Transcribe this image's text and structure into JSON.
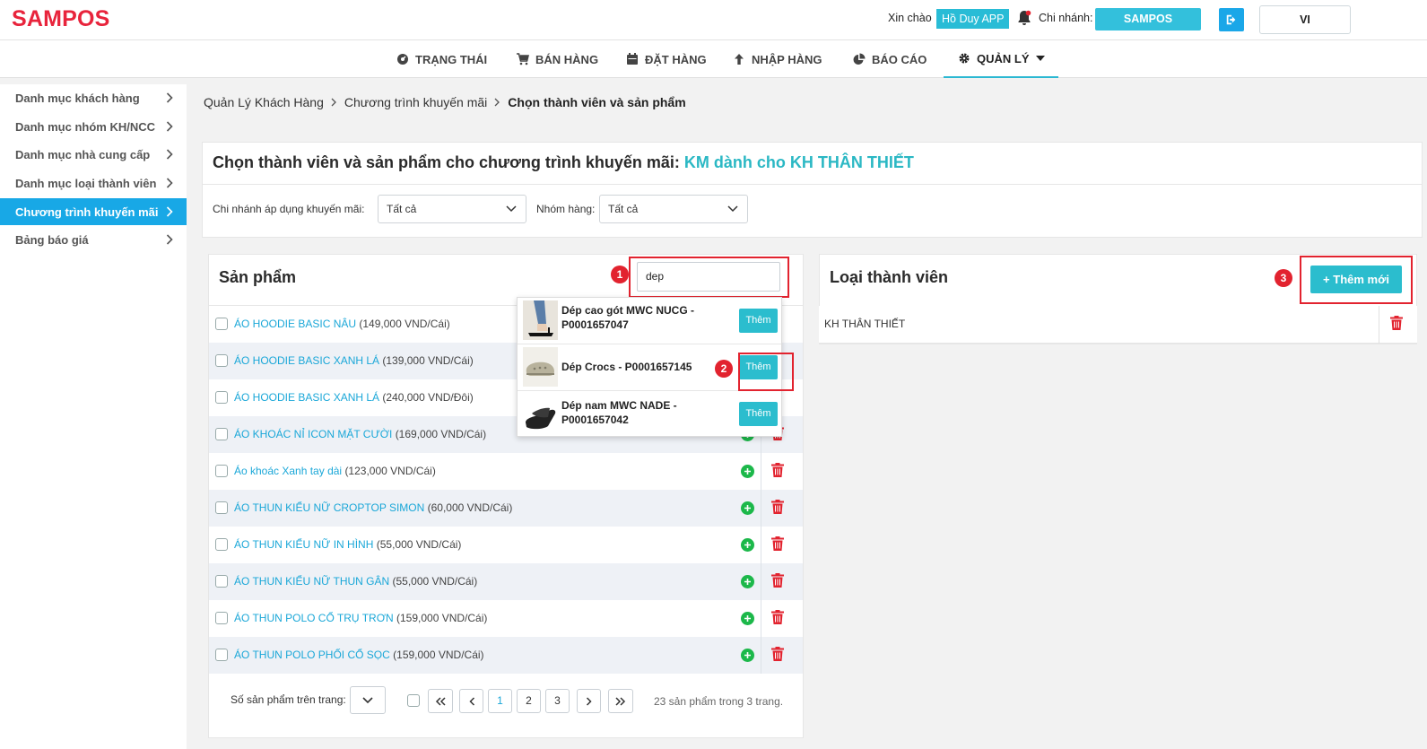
{
  "header": {
    "logo": "SAMPOS",
    "greeting": "Xin chào",
    "user_name": "Hồ Duy APP",
    "branch_label": "Chi nhánh:",
    "branch_value": "SAMPOS",
    "language": "VI"
  },
  "nav": {
    "items": [
      {
        "label": "TRẠNG THÁI",
        "icon": "dashboard-icon"
      },
      {
        "label": "BÁN HÀNG",
        "icon": "cart-icon"
      },
      {
        "label": "ĐẶT HÀNG",
        "icon": "calendar-icon"
      },
      {
        "label": "NHẬP HÀNG",
        "icon": "arrow-up-icon"
      },
      {
        "label": "BÁO CÁO",
        "icon": "pie-chart-icon"
      },
      {
        "label": "QUẢN LÝ",
        "icon": "gear-icon",
        "active": true
      }
    ]
  },
  "sidebar": {
    "items": [
      {
        "label": "Danh mục khách hàng"
      },
      {
        "label": "Danh mục nhóm KH/NCC"
      },
      {
        "label": "Danh mục nhà cung cấp"
      },
      {
        "label": "Danh mục loại thành viên"
      },
      {
        "label": "Chương trình khuyến mãi",
        "active": true
      },
      {
        "label": "Bảng báo giá"
      }
    ]
  },
  "breadcrumb": [
    "Quản Lý Khách Hàng",
    "Chương trình khuyến mãi",
    "Chọn thành viên và sản phẩm"
  ],
  "page": {
    "title": "Chọn thành viên và sản phẩm cho chương trình khuyến mãi:",
    "promo_name": "KM dành cho KH THÂN THIẾT",
    "filter_branch_label": "Chi nhánh áp dụng khuyến mãi:",
    "filter_branch_value": "Tất cả",
    "filter_group_label": "Nhóm hàng:",
    "filter_group_value": "Tất cả"
  },
  "products": {
    "title": "Sản phẩm",
    "search_value": "dep",
    "rows": [
      {
        "name": "ÁO HOODIE BASIC NÂU",
        "price": "(149,000 VND/Cái)"
      },
      {
        "name": "ÁO HOODIE BASIC XANH LÁ",
        "price": "(139,000 VND/Cái)"
      },
      {
        "name": "ÁO HOODIE BASIC XANH LÁ",
        "price": "(240,000 VND/Đôi)"
      },
      {
        "name": "ÁO KHOÁC NỈ ICON MẶT CƯỜI",
        "price": "(169,000 VND/Cái)"
      },
      {
        "name": "Áo khoác Xanh tay dài",
        "price": "(123,000 VND/Cái)"
      },
      {
        "name": "ÁO THUN KIỂU NỮ CROPTOP SIMON",
        "price": "(60,000 VND/Cái)"
      },
      {
        "name": "ÁO THUN KIỂU NỮ IN HÌNH",
        "price": "(55,000 VND/Cái)"
      },
      {
        "name": "ÁO THUN KIỂU NỮ THUN GÂN",
        "price": "(55,000 VND/Cái)"
      },
      {
        "name": "ÁO THUN POLO CỔ TRỤ TRƠN",
        "price": "(159,000 VND/Cái)"
      },
      {
        "name": "ÁO THUN POLO PHỐI CỔ SỌC",
        "price": "(159,000 VND/Cái)"
      }
    ],
    "suggestions": [
      {
        "name": "Dép cao gót MWC NUCG - P0001657047",
        "button": "Thêm"
      },
      {
        "name": "Dép Crocs - P0001657145",
        "button": "Thêm"
      },
      {
        "name": "Dép nam MWC NADE - P0001657042",
        "button": "Thêm"
      }
    ],
    "pagination": {
      "per_page_label": "Số sản phẩm trên trang:",
      "pages": [
        "1",
        "2",
        "3"
      ],
      "current": "1",
      "summary": "23 sản phẩm trong 3 trang."
    }
  },
  "members": {
    "title": "Loại thành viên",
    "add_button": "+ Thêm mới",
    "rows": [
      {
        "name": "KH THÂN THIẾT"
      }
    ]
  },
  "annotations": [
    "1",
    "2",
    "3"
  ],
  "colors": {
    "brand": "#e8243c",
    "accent": "#2bbdce",
    "active_sidebar": "#18a8e6",
    "link": "#1aa7d8",
    "add": "#1cb84a",
    "delete": "#e2232f",
    "highlight": "#e2232f"
  }
}
